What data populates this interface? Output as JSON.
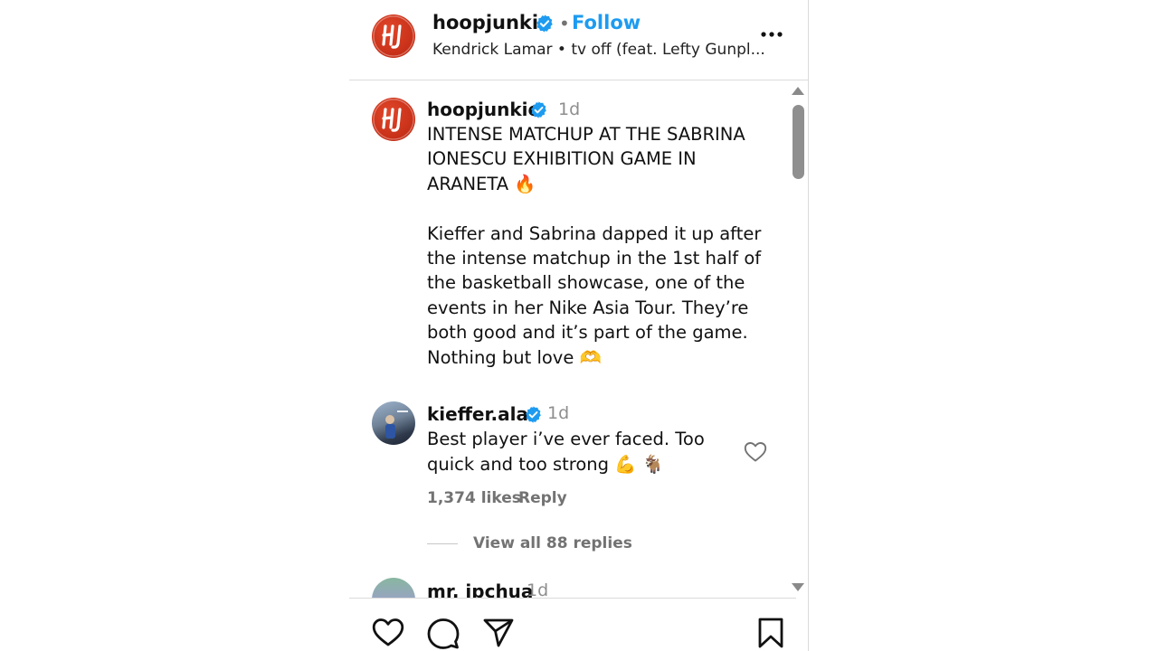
{
  "header": {
    "username": "hoopjunkie",
    "separator": "•",
    "follow_label": "Follow",
    "audio": "Kendrick Lamar • tv off (feat. Lefty Gunpl..."
  },
  "avatar": {
    "monogram": "HJ"
  },
  "post": {
    "username": "hoopjunkie",
    "time": "1d",
    "caption": "INTENSE MATCHUP AT THE SABRINA IONESCU EXHIBITION GAME IN ARANETA 🔥\n\nKieffer and Sabrina dapped it up after the intense matchup in the 1st half of the basketball showcase, one of the events in her Nike Asia Tour. They’re both good and it’s part of the game. Nothing but love 🫶"
  },
  "comments": [
    {
      "username": "kieffer.alas",
      "time": "1d",
      "text": "Best player i’ve ever faced. Too quick and too strong 💪 🐐",
      "likes": "1,374 likes",
      "reply_label": "Reply",
      "view_replies": "View all 88 replies"
    },
    {
      "username": "mr. ipchua",
      "time": "1d"
    }
  ],
  "colors": {
    "accent": "#1d9bf0",
    "brand_red": "#c62f17",
    "muted": "#737373"
  },
  "icons": [
    "verified-badge-icon",
    "more-options-icon",
    "heart-icon",
    "comment-icon",
    "share-icon",
    "bookmark-icon",
    "scroll-up-icon",
    "scroll-down-icon"
  ]
}
